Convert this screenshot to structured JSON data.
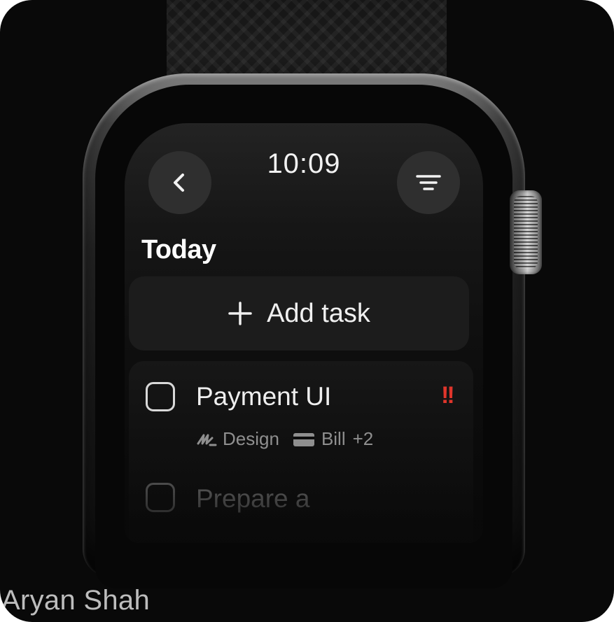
{
  "status_bar": {
    "time": "10:09"
  },
  "nav": {
    "back_icon": "chevron-left-icon",
    "filter_icon": "filter-lines-icon"
  },
  "section": {
    "title": "Today"
  },
  "add_task": {
    "icon": "plus-icon",
    "label": "Add task"
  },
  "tasks": [
    {
      "title": "Payment UI",
      "priority": "!!",
      "checked": false,
      "tags": [
        {
          "icon": "design-squiggle-icon",
          "label": "Design"
        },
        {
          "icon": "credit-card-icon",
          "label": "Bill"
        }
      ],
      "more_tags": "+2"
    },
    {
      "title": "Prepare a",
      "checked": false
    }
  ],
  "watermark": "Aryan Shah",
  "colors": {
    "background": "#090909",
    "priority": "#e0352b",
    "button": "#2f2f2f"
  }
}
